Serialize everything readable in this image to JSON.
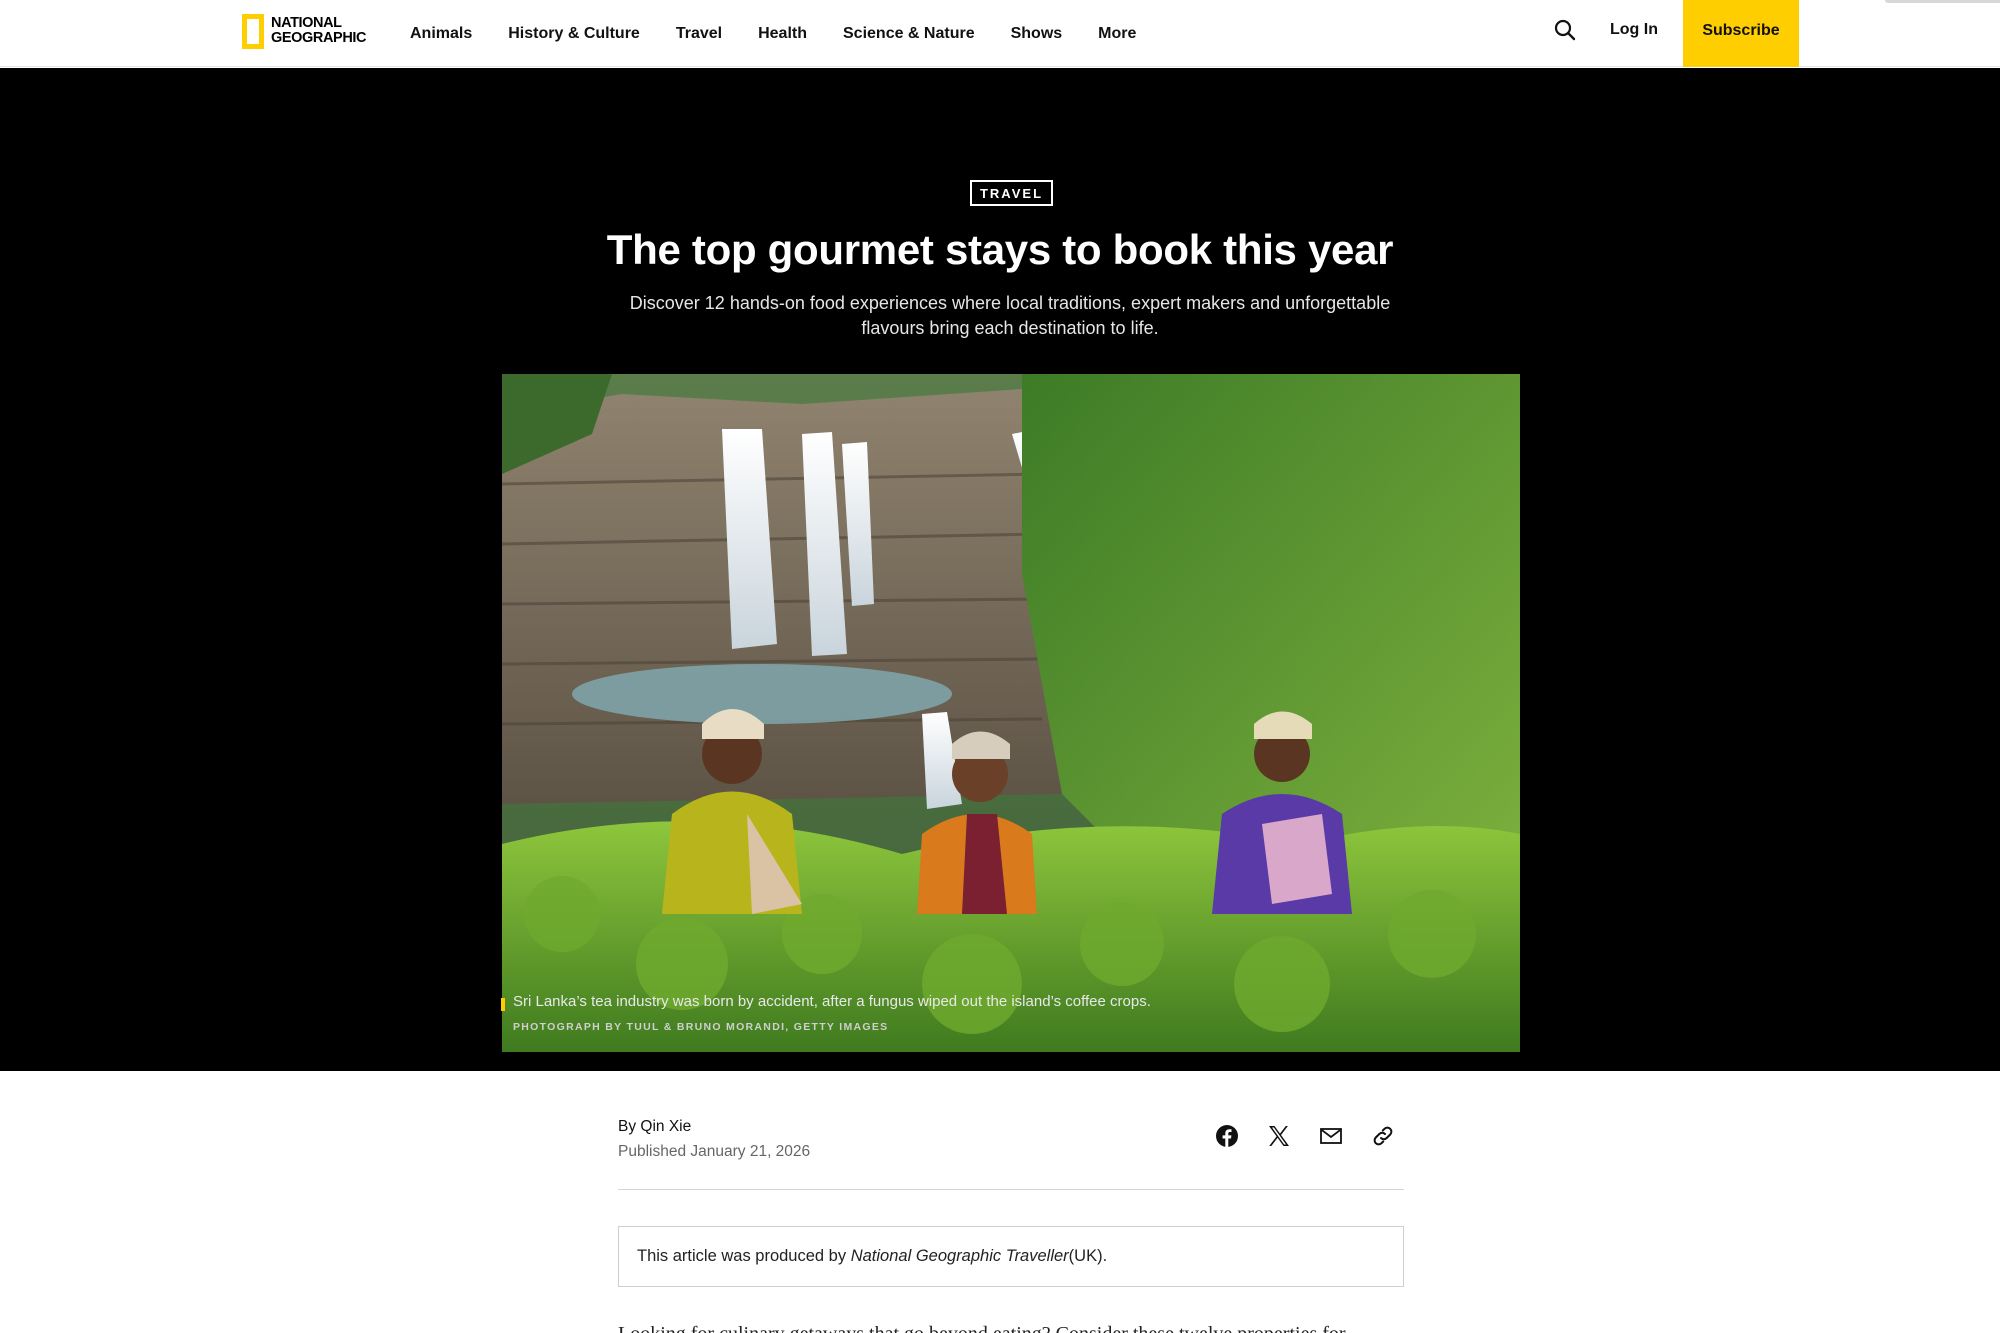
{
  "nav": {
    "logo_line1": "NATIONAL",
    "logo_line2": "GEOGRAPHIC",
    "links": [
      "Animals",
      "History & Culture",
      "Travel",
      "Health",
      "Science & Nature",
      "Shows",
      "More"
    ],
    "login": "Log In",
    "subscribe": "Subscribe",
    "brand_color": "#ffce00"
  },
  "hero": {
    "kicker": "TRAVEL",
    "headline": "The top gourmet stays to book this year",
    "dek": "Discover 12 hands-on food experiences where local traditions, expert makers and unforgettable flavours bring each destination to life.",
    "caption": "Sri Lanka’s tea industry was born by accident, after a fungus wiped out the island’s coffee crops.",
    "credit": "Photograph by Tuul & Bruno Morandi, Getty Images"
  },
  "article": {
    "byline_prefix": "By ",
    "author": "Qin Xie",
    "published": "Published January 21, 2026",
    "notice_prefix": "This article was produced by ",
    "notice_publication": "National Geographic Traveller",
    "notice_suffix": " (UK).",
    "body_peek": "Looking for culinary getaways that go beyond eating? Consider these twelve properties for cooking..."
  },
  "icons": {
    "search": "search-icon",
    "share": [
      "facebook-icon",
      "x-icon",
      "mail-icon",
      "link-icon"
    ]
  }
}
